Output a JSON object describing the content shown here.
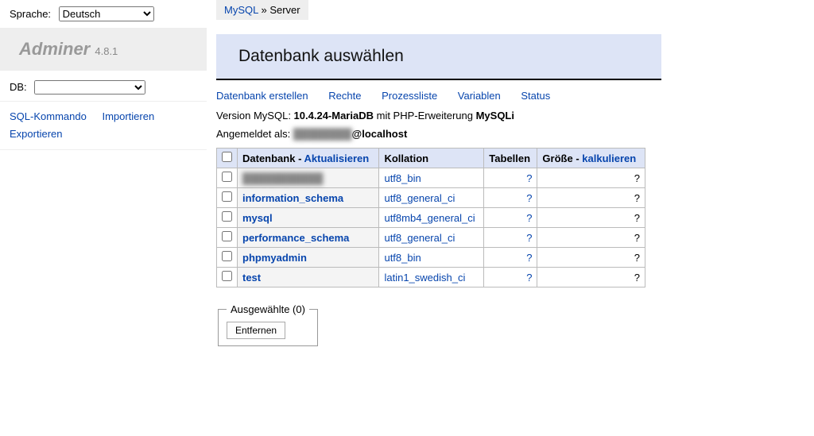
{
  "lang": {
    "label": "Sprache:",
    "selected": "Deutsch"
  },
  "logo": {
    "name": "Adminer",
    "version": "4.8.1"
  },
  "dbselect": {
    "label": "DB:",
    "selected": ""
  },
  "menu_links": {
    "sql": "SQL-Kommando",
    "import": "Importieren",
    "export": "Exportieren"
  },
  "breadcrumb": {
    "root": "MySQL",
    "sep": " » ",
    "current": "Server"
  },
  "heading": "Datenbank auswählen",
  "actions": {
    "create": "Datenbank erstellen",
    "privileges": "Rechte",
    "processlist": "Prozessliste",
    "variables": "Variablen",
    "status": "Status"
  },
  "version_line": {
    "prefix": "Version MySQL: ",
    "version": "10.4.24-MariaDB",
    "middle": " mit PHP-Erweiterung ",
    "ext": "MySQLi"
  },
  "login_line": {
    "prefix": "Angemeldet als: ",
    "user_hidden": "████████",
    "host": "@localhost"
  },
  "table": {
    "headers": {
      "database": "Datenbank",
      "refresh": "Aktualisieren",
      "collation": "Kollation",
      "tables": "Tabellen",
      "size": "Größe",
      "compute": "kalkulieren"
    },
    "rows": [
      {
        "name": "███████████",
        "hidden": true,
        "collation": "utf8_bin",
        "tables": "?",
        "size": "?"
      },
      {
        "name": "information_schema",
        "collation": "utf8_general_ci",
        "tables": "?",
        "size": "?"
      },
      {
        "name": "mysql",
        "collation": "utf8mb4_general_ci",
        "tables": "?",
        "size": "?"
      },
      {
        "name": "performance_schema",
        "collation": "utf8_general_ci",
        "tables": "?",
        "size": "?"
      },
      {
        "name": "phpmyadmin",
        "collation": "utf8_bin",
        "tables": "?",
        "size": "?"
      },
      {
        "name": "test",
        "collation": "latin1_swedish_ci",
        "tables": "?",
        "size": "?"
      }
    ]
  },
  "fieldset": {
    "legend": "Ausgewählte (0)",
    "drop": "Entfernen"
  }
}
